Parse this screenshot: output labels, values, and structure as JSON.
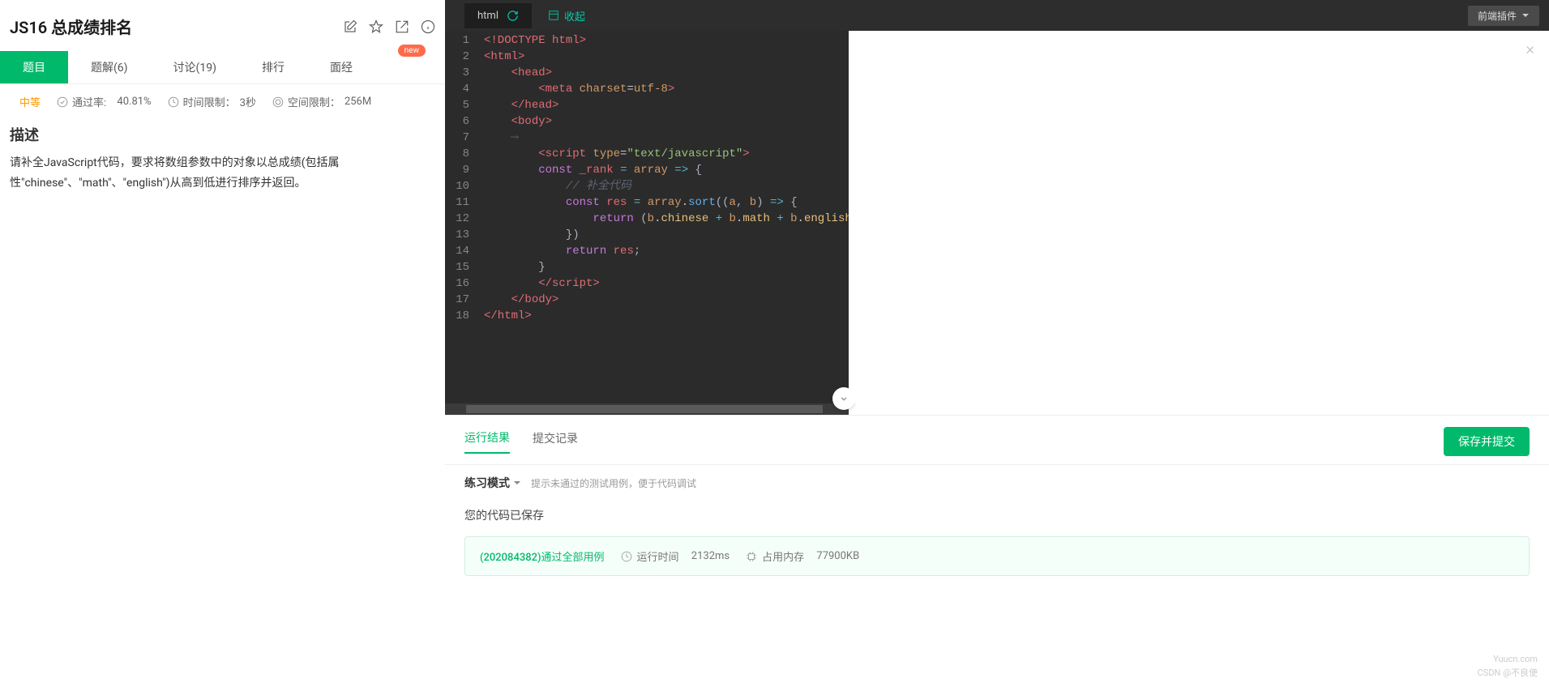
{
  "problem": {
    "title": "JS16  总成绩排名",
    "difficulty": "中等",
    "pass_rate_label": "通过率:",
    "pass_rate_value": "40.81%",
    "time_limit_label": "时间限制：",
    "time_limit_value": "3秒",
    "space_limit_label": "空间限制：",
    "space_limit_value": "256M"
  },
  "tabs": {
    "items": [
      "题目",
      "题解(6)",
      "讨论(19)",
      "排行",
      "面经"
    ],
    "badge_new": "new"
  },
  "description": {
    "heading": "描述",
    "body": "请补全JavaScript代码，要求将数组参数中的对象以总成绩(包括属性\"chinese\"、\"math\"、\"english\")从高到低进行排序并返回。"
  },
  "editor": {
    "language": "html",
    "collapse": "收起",
    "plugin_btn": "前端插件",
    "line_numbers": [
      "1",
      "2",
      "3",
      "4",
      "5",
      "6",
      "7",
      "8",
      "9",
      "10",
      "11",
      "12",
      "13",
      "14",
      "15",
      "16",
      "17",
      "18"
    ]
  },
  "result_tabs": {
    "run": "运行结果",
    "history": "提交记录",
    "submit_btn": "保存并提交"
  },
  "practice": {
    "mode_label": "练习模式",
    "hint": "提示未通过的测试用例，便于代码调试",
    "saved_msg": "您的代码已保存"
  },
  "pass": {
    "main": "(202084382)通过全部用例",
    "time_label": "运行时间",
    "time_value": "2132ms",
    "mem_label": "占用内存",
    "mem_value": "77900KB"
  },
  "watermark": {
    "site": "Yuucn.com",
    "author": "CSDN @不良使"
  }
}
